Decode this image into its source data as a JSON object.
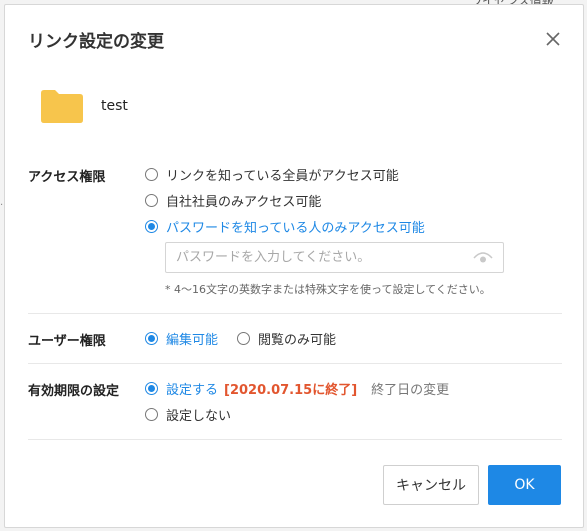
{
  "background": {
    "text": "ライセンス情報"
  },
  "dialog": {
    "title": "リンク設定の変更",
    "close_icon": "close-icon"
  },
  "file": {
    "icon": "folder-icon",
    "name": "test",
    "folder_color": "#f7c54c"
  },
  "access": {
    "label": "アクセス権限",
    "options": [
      {
        "label": "リンクを知っている全員がアクセス可能",
        "selected": false
      },
      {
        "label": "自社社員のみアクセス可能",
        "selected": false
      },
      {
        "label": "パスワードを知っている人のみアクセス可能",
        "selected": true
      }
    ],
    "password": {
      "value": "",
      "placeholder": "パスワードを入力してください。",
      "icon": "eye-icon"
    },
    "hint": "* 4〜16文字の英数字または特殊文字を使って設定してください。"
  },
  "user": {
    "label": "ユーザー権限",
    "options": [
      {
        "label": "編集可能",
        "selected": true
      },
      {
        "label": "閲覧のみ可能",
        "selected": false
      }
    ]
  },
  "expiry": {
    "label": "有効期限の設定",
    "options": [
      {
        "label": "設定する",
        "selected": true
      },
      {
        "label": "設定しない",
        "selected": false
      }
    ],
    "end_date": "[2020.07.15に終了]",
    "change_label": "終了日の変更"
  },
  "buttons": {
    "cancel": "キャンセル",
    "ok": "OK"
  },
  "colors": {
    "accent": "#1e88e5",
    "warning": "#e2562f"
  }
}
